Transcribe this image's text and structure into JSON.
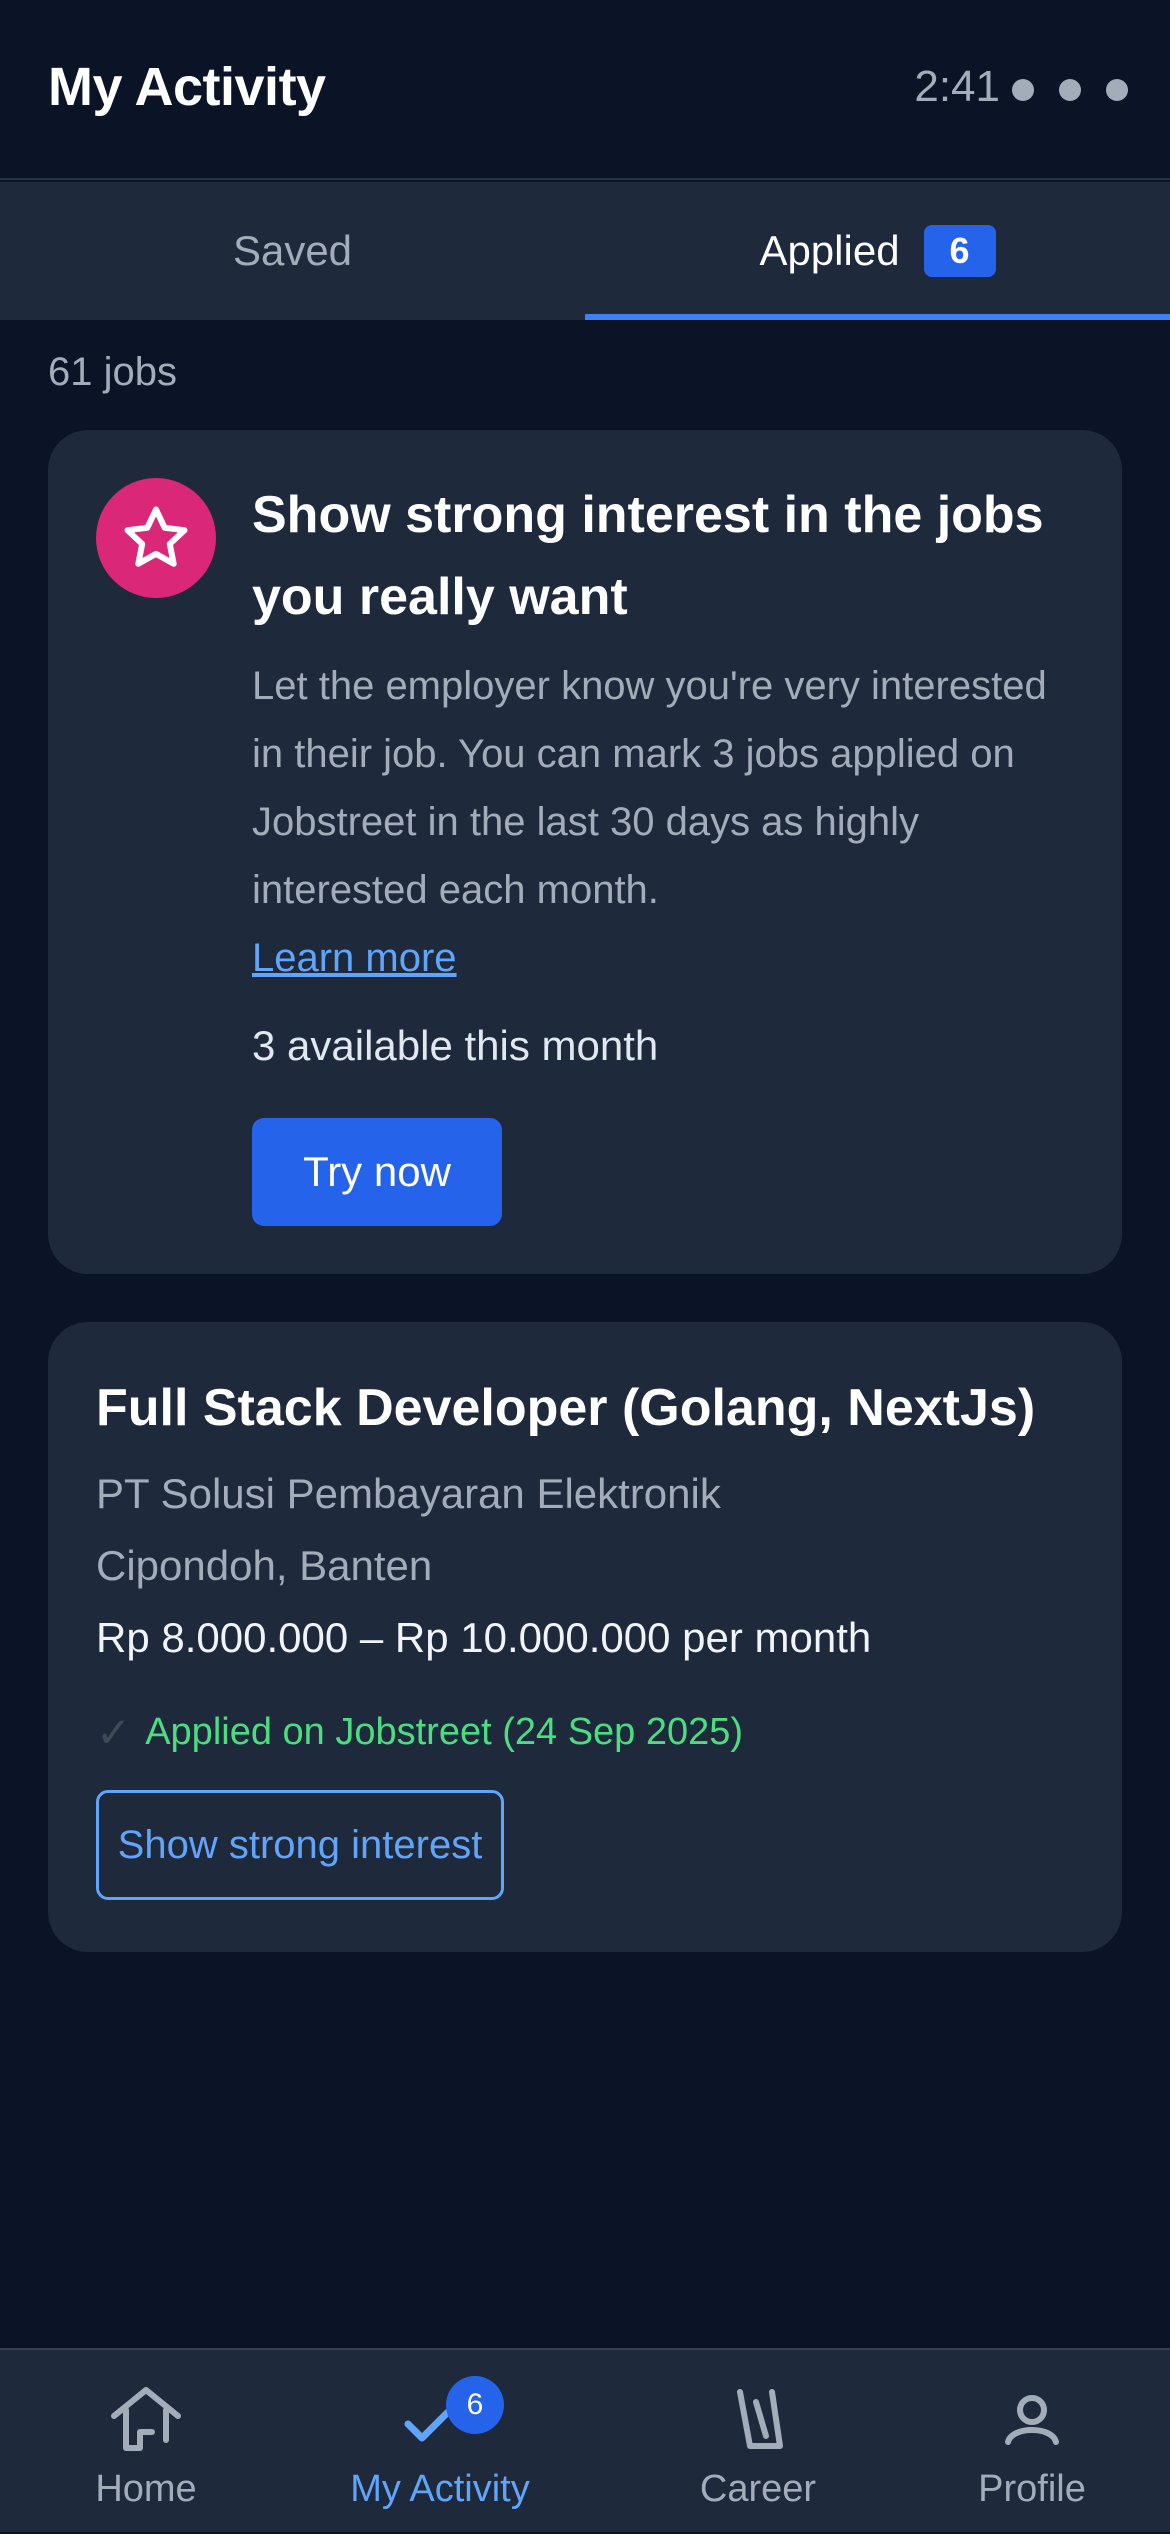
{
  "header": {
    "title": "My Activity",
    "time": "2:41"
  },
  "tabs": [
    {
      "label": "Saved"
    },
    {
      "label": "Applied",
      "badge": "6"
    }
  ],
  "jobs_count": "61 jobs",
  "promo": {
    "icon": "star-icon",
    "title": "Show strong interest in the jobs you really want",
    "body": "Let the employer know you're very interested in their job. You can mark 3 jobs applied on Jobstreet in the last 30 days as highly interested each month.",
    "learn_more": "Learn more",
    "available": "3 available this month",
    "button": "Try now"
  },
  "job": {
    "title": "Full Stack Developer (Golang, NextJs)",
    "company": "PT Solusi Pembayaran Elektronik",
    "location": "Cipondoh, Banten",
    "salary": "Rp 8.000.000 – Rp 10.000.000 per month",
    "status": "Applied on Jobstreet (24 Sep 2025)",
    "button": "Show strong interest"
  },
  "nav": [
    {
      "label": "Home",
      "icon": "home-icon"
    },
    {
      "label": "My Activity",
      "icon": "check-icon",
      "badge": "6"
    },
    {
      "label": "Career",
      "icon": "career-icon"
    },
    {
      "label": "Profile",
      "icon": "profile-icon"
    }
  ],
  "colors": {
    "accent": "#2563eb",
    "link": "#60a5fa",
    "success": "#4ade80",
    "star": "#db2777"
  }
}
